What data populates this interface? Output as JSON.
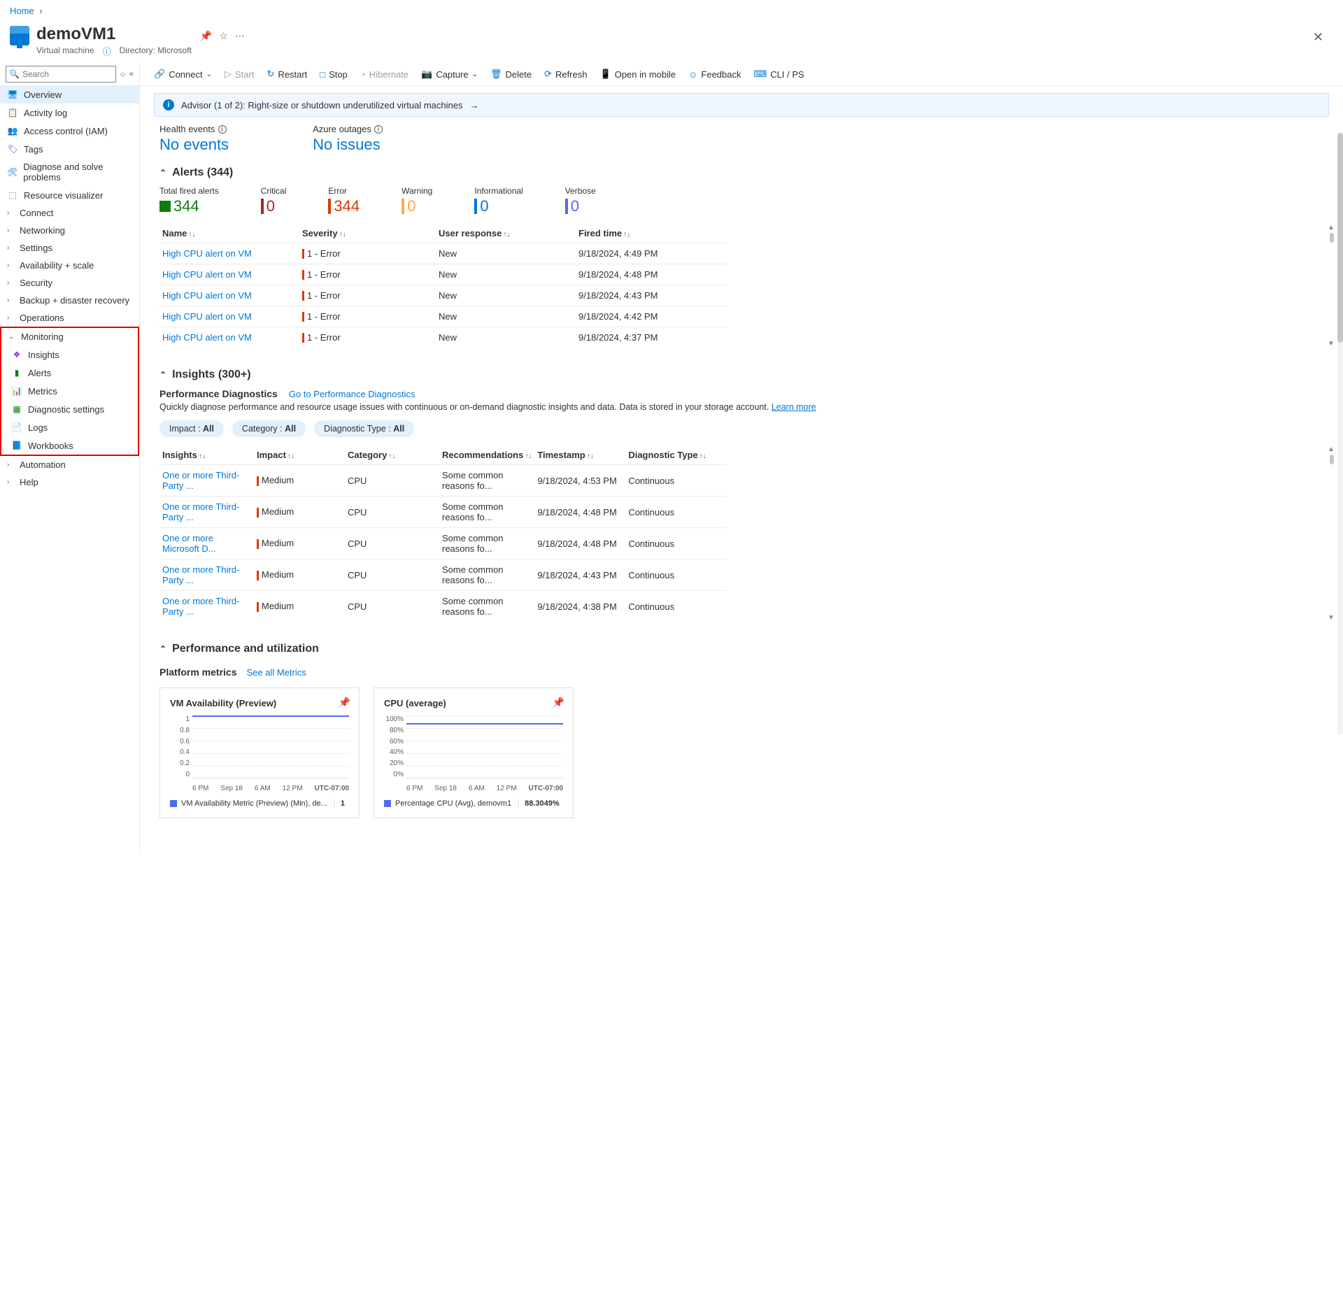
{
  "breadcrumb": {
    "home": "Home"
  },
  "header": {
    "title": "demoVM1",
    "resource_type": "Virtual machine",
    "directory_label": "Directory: Microsoft"
  },
  "sidebar": {
    "search_placeholder": "Search",
    "items": {
      "overview": "Overview",
      "activity": "Activity log",
      "iam": "Access control (IAM)",
      "tags": "Tags",
      "diagnose": "Diagnose and solve problems",
      "resviz": "Resource visualizer",
      "connect": "Connect",
      "networking": "Networking",
      "settings": "Settings",
      "availability": "Availability + scale",
      "security": "Security",
      "backup": "Backup + disaster recovery",
      "operations": "Operations",
      "monitoring": "Monitoring",
      "insights": "Insights",
      "alerts": "Alerts",
      "metrics": "Metrics",
      "diagset": "Diagnostic settings",
      "logs": "Logs",
      "workbooks": "Workbooks",
      "automation": "Automation",
      "help": "Help"
    }
  },
  "toolbar": {
    "connect": "Connect",
    "start": "Start",
    "restart": "Restart",
    "stop": "Stop",
    "hibernate": "Hibernate",
    "capture": "Capture",
    "delete": "Delete",
    "refresh": "Refresh",
    "open_mobile": "Open in mobile",
    "feedback": "Feedback",
    "cli": "CLI / PS"
  },
  "advisor": {
    "text": "Advisor (1 of 2): Right-size or shutdown underutilized virtual machines"
  },
  "health": {
    "events_label": "Health events",
    "events_val": "No events",
    "outages_label": "Azure outages",
    "outages_val": "No issues"
  },
  "alerts": {
    "heading": "Alerts (344)",
    "stats": [
      {
        "label": "Total fired alerts",
        "value": "344",
        "color": "#107c10",
        "icon": true
      },
      {
        "label": "Critical",
        "value": "0",
        "color": "#a4262c"
      },
      {
        "label": "Error",
        "value": "344",
        "color": "#da3b01"
      },
      {
        "label": "Warning",
        "value": "0",
        "color": "#ffaa44"
      },
      {
        "label": "Informational",
        "value": "0",
        "color": "#0078d4"
      },
      {
        "label": "Verbose",
        "value": "0",
        "color": "#4f6bed"
      }
    ],
    "cols": {
      "name": "Name",
      "severity": "Severity",
      "user": "User response",
      "fired": "Fired time"
    },
    "rows": [
      {
        "name": "High CPU alert on VM",
        "severity": "1 - Error",
        "user": "New",
        "fired": "9/18/2024, 4:49 PM"
      },
      {
        "name": "High CPU alert on VM",
        "severity": "1 - Error",
        "user": "New",
        "fired": "9/18/2024, 4:48 PM"
      },
      {
        "name": "High CPU alert on VM",
        "severity": "1 - Error",
        "user": "New",
        "fired": "9/18/2024, 4:43 PM"
      },
      {
        "name": "High CPU alert on VM",
        "severity": "1 - Error",
        "user": "New",
        "fired": "9/18/2024, 4:42 PM"
      },
      {
        "name": "High CPU alert on VM",
        "severity": "1 - Error",
        "user": "New",
        "fired": "9/18/2024, 4:37 PM"
      }
    ]
  },
  "insights": {
    "heading": "Insights (300+)",
    "perf_title": "Performance Diagnostics",
    "perf_link": "Go to Performance Diagnostics",
    "perf_desc": "Quickly diagnose performance and resource usage issues with continuous or on-demand diagnostic insights and data. Data is stored in your storage account. ",
    "learn": "Learn more",
    "pills": [
      {
        "pre": "Impact : ",
        "b": "All"
      },
      {
        "pre": "Category : ",
        "b": "All"
      },
      {
        "pre": "Diagnostic Type : ",
        "b": "All"
      }
    ],
    "cols": {
      "insights": "Insights",
      "impact": "Impact",
      "category": "Category",
      "rec": "Recommendations",
      "ts": "Timestamp",
      "dtype": "Diagnostic Type"
    },
    "rows": [
      {
        "name": "One or more Third-Party ...",
        "impact": "Medium",
        "cat": "CPU",
        "rec": "Some common reasons fo...",
        "ts": "9/18/2024, 4:53 PM",
        "dt": "Continuous"
      },
      {
        "name": "One or more Third-Party ...",
        "impact": "Medium",
        "cat": "CPU",
        "rec": "Some common reasons fo...",
        "ts": "9/18/2024, 4:48 PM",
        "dt": "Continuous"
      },
      {
        "name": "One or more Microsoft D...",
        "impact": "Medium",
        "cat": "CPU",
        "rec": "Some common reasons fo...",
        "ts": "9/18/2024, 4:48 PM",
        "dt": "Continuous"
      },
      {
        "name": "One or more Third-Party ...",
        "impact": "Medium",
        "cat": "CPU",
        "rec": "Some common reasons fo...",
        "ts": "9/18/2024, 4:43 PM",
        "dt": "Continuous"
      },
      {
        "name": "One or more Third-Party ...",
        "impact": "Medium",
        "cat": "CPU",
        "rec": "Some common reasons fo...",
        "ts": "9/18/2024, 4:38 PM",
        "dt": "Continuous"
      }
    ]
  },
  "perf": {
    "heading": "Performance and utilization",
    "platform": "Platform metrics",
    "see_all": "See all Metrics"
  },
  "charts": {
    "vm": {
      "title": "VM Availability (Preview)",
      "legend": "VM Availability Metric (Preview) (Min), de...",
      "value": "1",
      "tz": "UTC-07:00",
      "yticks": [
        "1",
        "0.8",
        "0.6",
        "0.4",
        "0.2",
        "0"
      ],
      "xticks": [
        "6 PM",
        "Sep 18",
        "6 AM",
        "12 PM"
      ]
    },
    "cpu": {
      "title": "CPU (average)",
      "legend": "Percentage CPU (Avg), demovm1",
      "value": "88.3049%",
      "tz": "UTC-07:00",
      "yticks": [
        "100%",
        "80%",
        "60%",
        "40%",
        "20%",
        "0%"
      ],
      "xticks": [
        "6 PM",
        "Sep 18",
        "6 AM",
        "12 PM"
      ]
    }
  },
  "chart_data": [
    {
      "type": "line",
      "title": "VM Availability (Preview)",
      "ylabel": "",
      "xlabel": "",
      "ylim": [
        0,
        1
      ],
      "x": [
        "6 PM",
        "Sep 18",
        "6 AM",
        "12 PM"
      ],
      "series": [
        {
          "name": "VM Availability Metric (Preview) (Min)",
          "constant": 1
        }
      ]
    },
    {
      "type": "line",
      "title": "CPU (average)",
      "ylabel": "",
      "xlabel": "",
      "ylim": [
        0,
        100
      ],
      "x": [
        "6 PM",
        "Sep 18",
        "6 AM",
        "12 PM"
      ],
      "series": [
        {
          "name": "Percentage CPU (Avg), demovm1",
          "approx": 88.3,
          "summary_value": "88.3049%"
        }
      ]
    }
  ]
}
